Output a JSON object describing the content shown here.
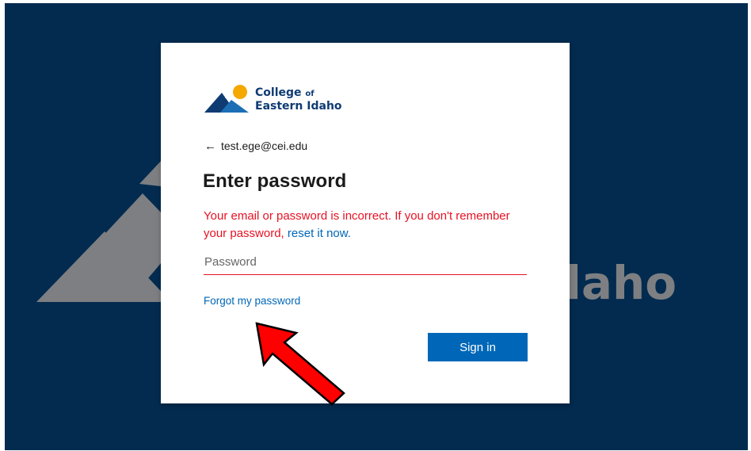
{
  "background": {
    "wordmark_fragment": "laho"
  },
  "brand": {
    "line1": "College",
    "line1_of": "of",
    "line2": "Eastern Idaho"
  },
  "identity": {
    "back_icon": "left-arrow",
    "email": "test.ege@cei.edu"
  },
  "title": "Enter password",
  "error": {
    "message": "Your email or password is incorrect. If you don't remember your password, ",
    "link": "reset it now."
  },
  "password": {
    "placeholder": "Password",
    "value": ""
  },
  "forgot_link": "Forgot my password",
  "signin_label": "Sign in",
  "colors": {
    "page_bg": "#032b4f",
    "accent": "#0067b8",
    "error": "#e81123",
    "brand_navy": "#0f3b73",
    "brand_sun": "#f5a800",
    "annotation_arrow": "#ff0000"
  }
}
